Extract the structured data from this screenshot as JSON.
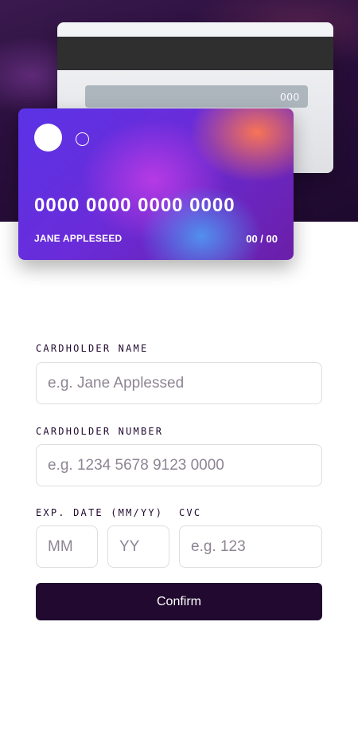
{
  "card_back": {
    "cvc": "000"
  },
  "card_front": {
    "number": "0000 0000 0000 0000",
    "holder": "JANE APPLESEED",
    "expiry": "00 / 00"
  },
  "form": {
    "name_label": "Cardholder Name",
    "name_placeholder": "e.g. Jane Applessed",
    "number_label": "Cardholder Number",
    "number_placeholder": "e.g. 1234 5678 9123 0000",
    "exp_label": "Exp. Date (MM/YY)",
    "cvc_label": "CVC",
    "mm_placeholder": "MM",
    "yy_placeholder": "YY",
    "cvc_placeholder": "e.g. 123",
    "confirm_label": "Confirm"
  },
  "colors": {
    "dark_violet": "#21092f",
    "input_border": "#dedddf",
    "placeholder": "#8e8593"
  }
}
